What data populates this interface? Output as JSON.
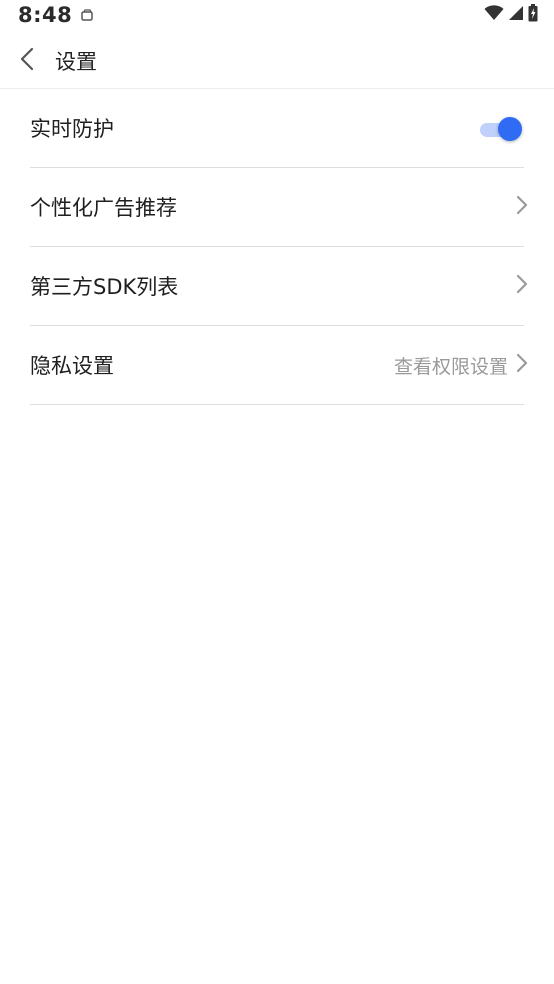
{
  "status_bar": {
    "time": "8:48",
    "icons": [
      "notification-icon",
      "wifi-icon",
      "signal-icon",
      "battery-icon"
    ]
  },
  "header": {
    "back_icon": "chevron-left-icon",
    "title": "设置"
  },
  "settings": {
    "items": [
      {
        "label": "实时防护",
        "control": "toggle",
        "checked": true
      },
      {
        "label": "个性化广告推荐",
        "control": "chevron"
      },
      {
        "label": "第三方SDK列表",
        "control": "chevron"
      },
      {
        "label": "隐私设置",
        "value": "查看权限设置",
        "control": "chevron"
      }
    ]
  },
  "colors": {
    "accent": "#2f6cf3",
    "toggle_track": "#bfd0fb",
    "divider": "#dedede",
    "secondary_text": "#9a9a9a"
  }
}
